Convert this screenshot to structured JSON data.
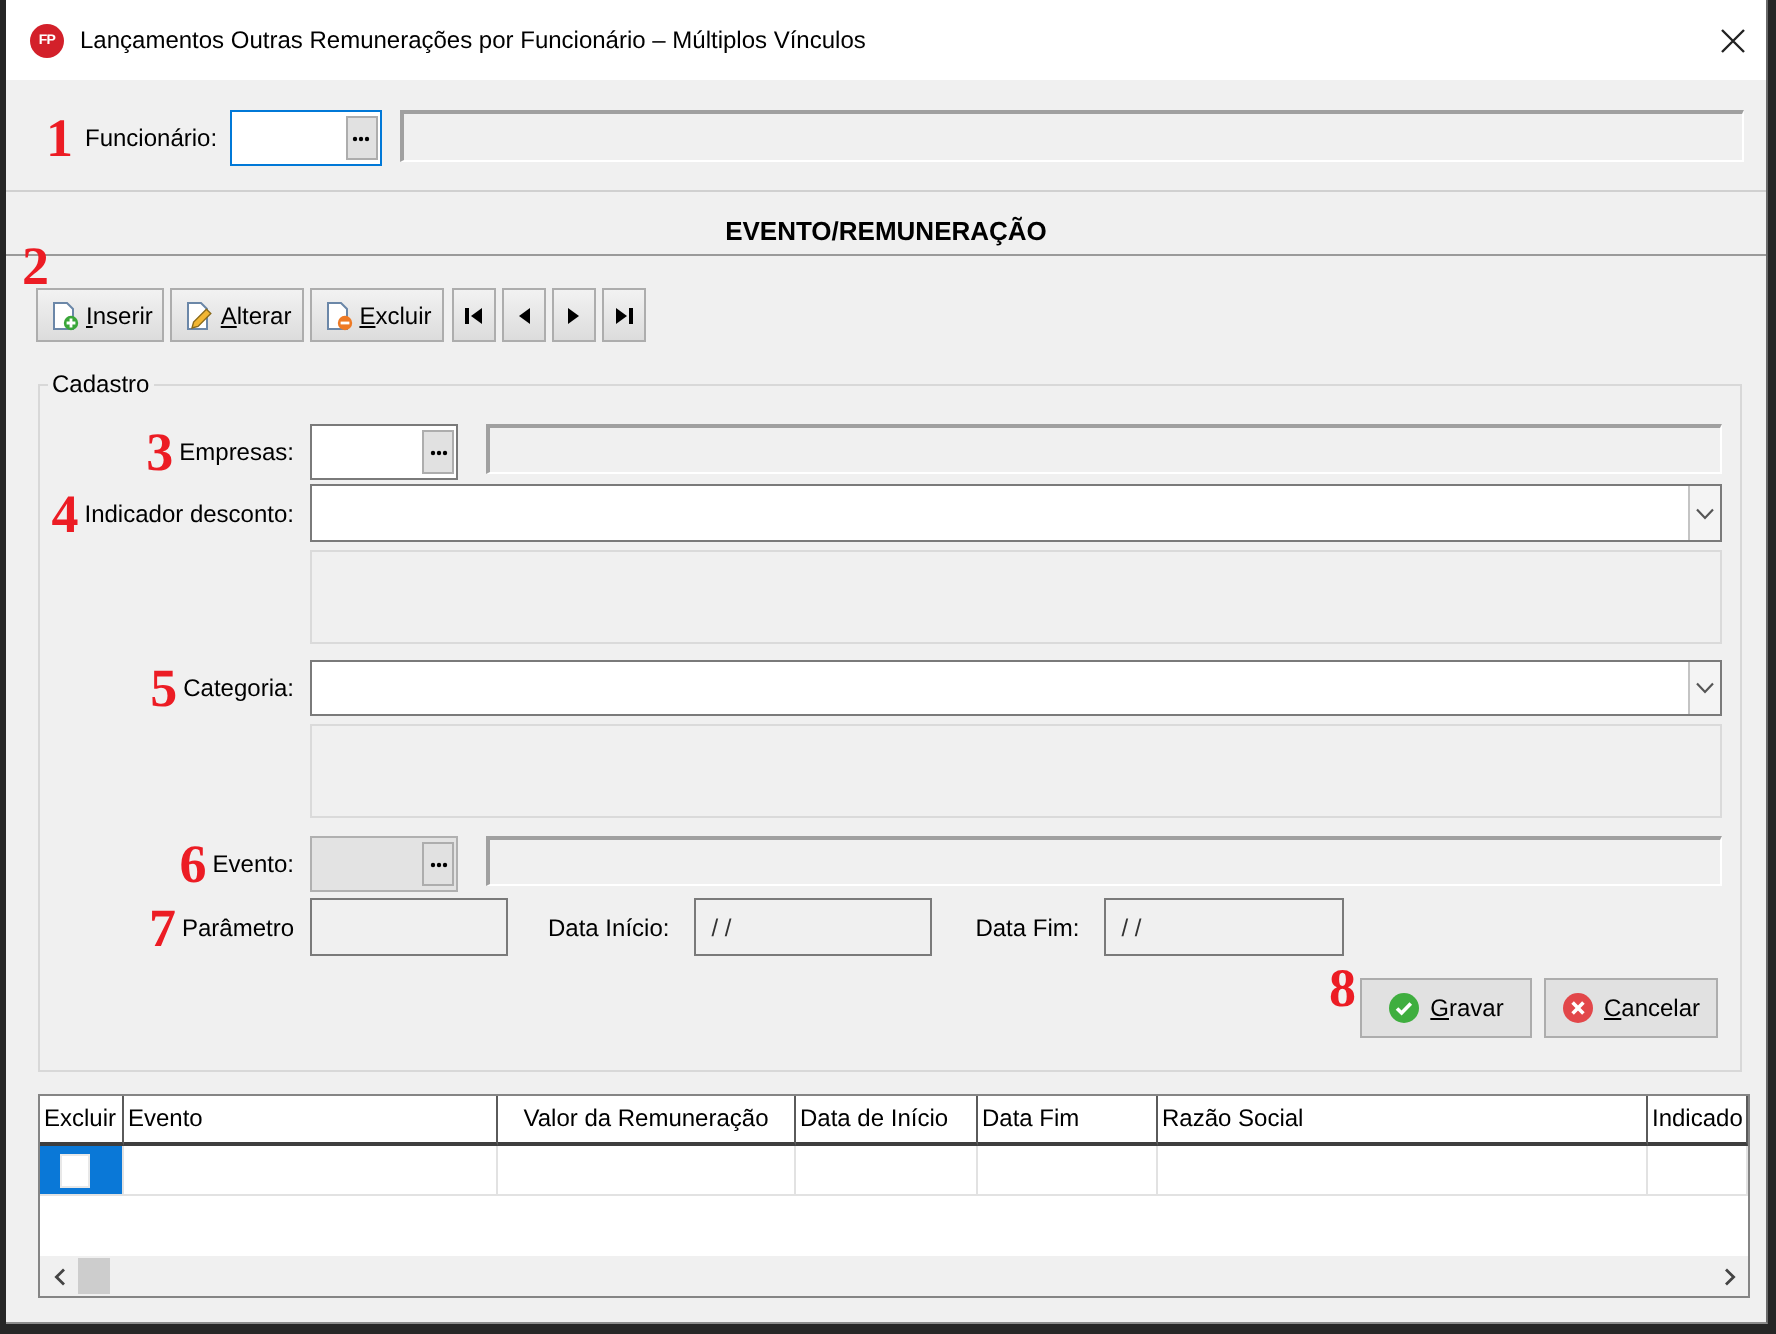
{
  "window": {
    "title": "Lançamentos Outras Remunerações por Funcionário – Múltiplos Vínculos",
    "logo": "FP"
  },
  "employee": {
    "marker": "1",
    "label": "Funcionário:",
    "focused": true
  },
  "section_title": "EVENTO/REMUNERAÇÃO",
  "toolbar": {
    "marker": "2",
    "buttons": [
      {
        "kind": "insert",
        "label": "Inserir"
      },
      {
        "kind": "edit",
        "label": "Alterar"
      },
      {
        "kind": "delete",
        "label": "Excluir"
      },
      {
        "kind": "first"
      },
      {
        "kind": "prev"
      },
      {
        "kind": "next"
      },
      {
        "kind": "last"
      }
    ]
  },
  "form": {
    "title": "Cadastro",
    "rows": [
      {
        "kind": "lookup",
        "marker": "3",
        "label": "Empresas:",
        "disabled": false
      },
      {
        "kind": "combo",
        "marker": "4",
        "label": "Indicador desconto:"
      },
      {
        "kind": "combo",
        "marker": "5",
        "label": "Categoria:"
      },
      {
        "kind": "lookup",
        "marker": "6",
        "label": "Evento:",
        "disabled": true
      }
    ],
    "params": {
      "marker": "7",
      "fields": [
        {
          "label": "Parâmetro"
        },
        {
          "label": "Data Início:",
          "value": "/ /"
        },
        {
          "label": "Data Fim:",
          "value": "/ /"
        }
      ]
    },
    "actions": {
      "marker": "8",
      "buttons": [
        {
          "kind": "save",
          "label": "Gravar"
        },
        {
          "kind": "cancel",
          "label": "Cancelar"
        }
      ]
    }
  },
  "grid": {
    "columns": [
      "Excluir",
      "Evento",
      "Valor da Remuneração",
      "Data de Início",
      "Data Fim",
      "Razão Social",
      "Indicado"
    ],
    "rows": [
      {
        "selected": true,
        "checked": false
      }
    ]
  }
}
